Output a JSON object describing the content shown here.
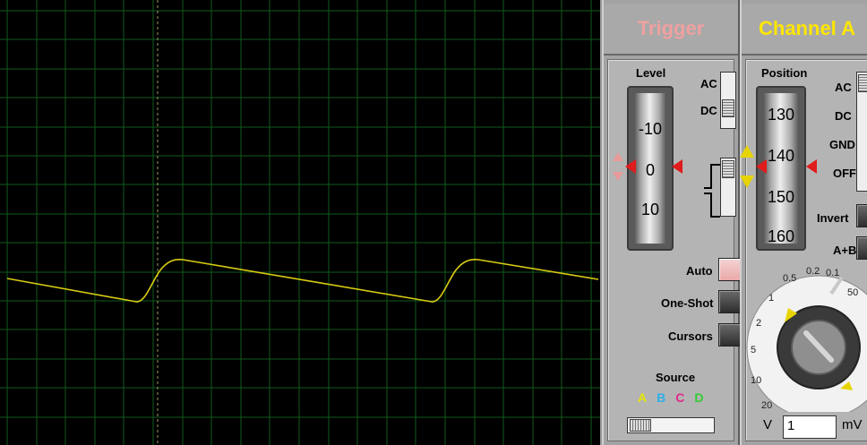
{
  "scope": {
    "grid_color": "#0f5a1c",
    "trace_color": "#d8cc12",
    "cursor_color": "#9a9a6a"
  },
  "trigger": {
    "title": "Trigger",
    "title_color": "#f0a0a0",
    "level_label": "Level",
    "level_ticks": [
      "-10",
      "0",
      "10"
    ],
    "coupling": [
      "AC",
      "DC"
    ],
    "auto_label": "Auto",
    "oneshot_label": "One-Shot",
    "cursors_label": "Cursors",
    "source_label": "Source",
    "sources": [
      {
        "key": "A",
        "color": "#e6e600"
      },
      {
        "key": "B",
        "color": "#2fb0e8"
      },
      {
        "key": "C",
        "color": "#e02a8c"
      },
      {
        "key": "D",
        "color": "#33cc33"
      }
    ]
  },
  "channel_a": {
    "title": "Channel A",
    "title_color": "#ffe600",
    "position_label": "Position",
    "position_ticks": [
      "130",
      "140",
      "150",
      "160"
    ],
    "coupling": [
      "AC",
      "DC",
      "GND",
      "OFF"
    ],
    "invert_label": "Invert",
    "aplusb_label": "A+B",
    "dial_labels": [
      "0.5",
      "0.2",
      "0.1",
      "1",
      "2",
      "5",
      "10",
      "20",
      "50",
      "20",
      "10",
      "5",
      "2"
    ],
    "unit_left": "V",
    "unit_right": "mV",
    "scale_value": "1"
  }
}
